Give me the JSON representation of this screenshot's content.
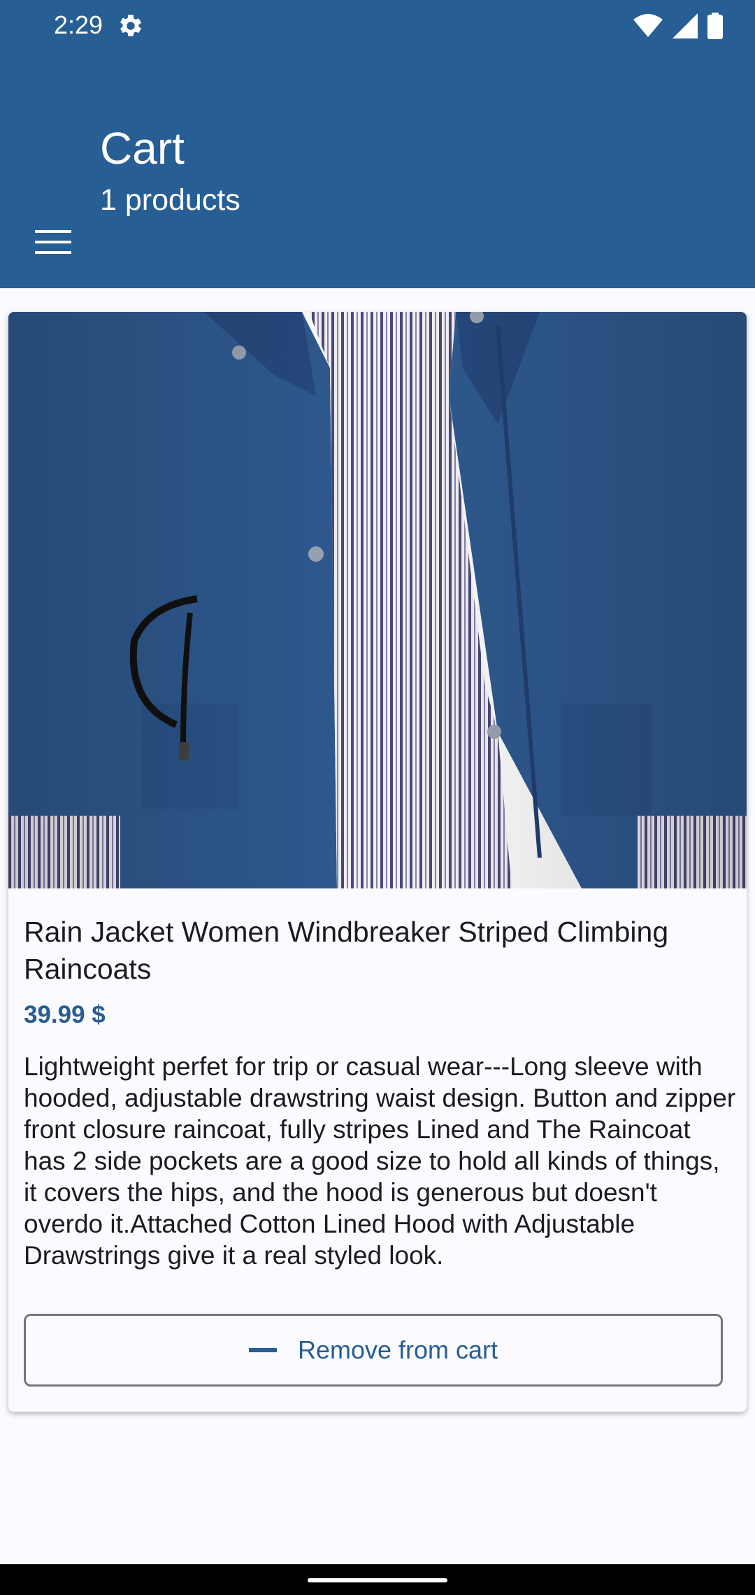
{
  "status_bar": {
    "time": "2:29",
    "icons": [
      "settings-gear-icon",
      "wifi-icon",
      "cell-signal-icon",
      "battery-icon"
    ]
  },
  "app_bar": {
    "title": "Cart",
    "subtitle": "1 products",
    "menu_icon": "hamburger-menu-icon"
  },
  "product": {
    "image_icon": "rain-jacket-photo",
    "title": "Rain Jacket Women Windbreaker Striped Climbing Raincoats",
    "price": "39.99 $",
    "description": "Lightweight perfet for trip or casual wear---Long sleeve with hooded, adjustable drawstring waist design. Button and zipper front closure raincoat, fully stripes Lined and The Raincoat has 2 side pockets are a good size to hold all kinds of things, it covers the hips, and the hood is generous but doesn't overdo it.Attached Cotton Lined Hood with Adjustable Drawstrings give it a real styled look.",
    "remove_button_label": "Remove from cart",
    "remove_icon": "minus-icon"
  },
  "colors": {
    "primary": "#275E93",
    "background": "#FBFAFE",
    "text": "#1C1B1F",
    "outline": "#73777F"
  }
}
